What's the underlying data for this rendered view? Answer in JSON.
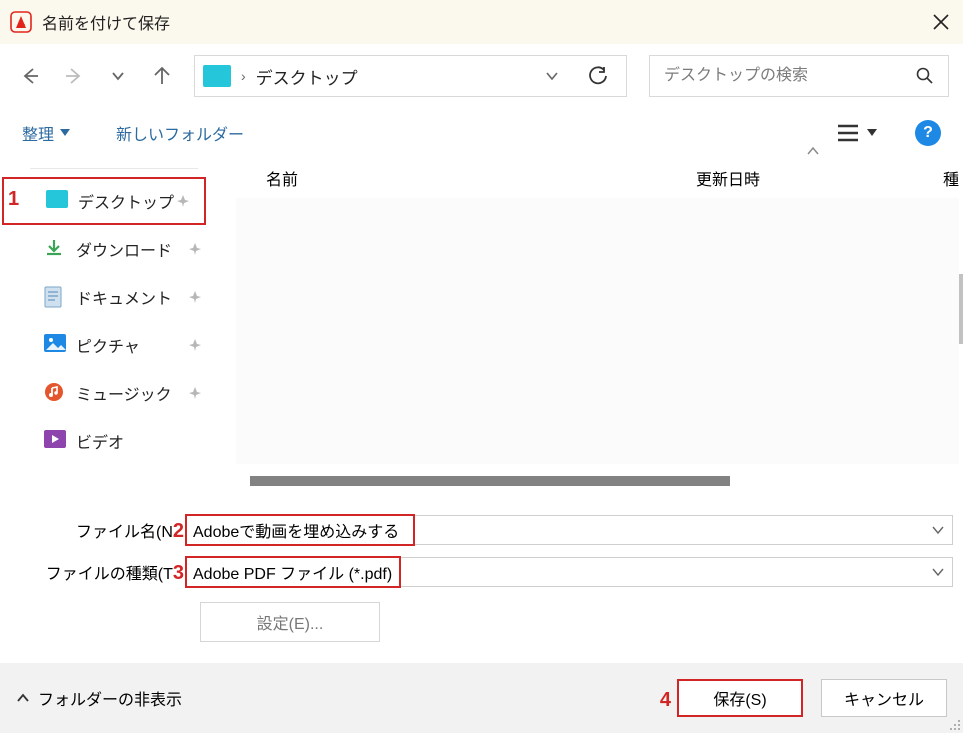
{
  "window": {
    "title": "名前を付けて保存"
  },
  "nav": {
    "path_location": "デスクトップ"
  },
  "search": {
    "placeholder": "デスクトップの検索"
  },
  "toolbar": {
    "organize": "整理",
    "new_folder": "新しいフォルダー",
    "help": "?"
  },
  "sidebar": {
    "items": [
      {
        "label": "デスクトップ",
        "icon": "desktop",
        "color": "#26c6da"
      },
      {
        "label": "ダウンロード",
        "icon": "download",
        "color": "#3aa555"
      },
      {
        "label": "ドキュメント",
        "icon": "document",
        "color": "#7ea6c9"
      },
      {
        "label": "ピクチャ",
        "icon": "picture",
        "color": "#1e88e5"
      },
      {
        "label": "ミュージック",
        "icon": "music",
        "color": "#e4572e"
      },
      {
        "label": "ビデオ",
        "icon": "video",
        "color": "#8e44ad"
      }
    ]
  },
  "columns": {
    "name": "名前",
    "modified": "更新日時",
    "type": "種"
  },
  "fields": {
    "filename_label": "ファイル名(N):",
    "filename_label_vis": "ファイル名(N",
    "filename_value": "Adobeで動画を埋め込みする",
    "filetype_label": "ファイルの種類(T):",
    "filetype_label_vis": "ファイルの種類(T",
    "filetype_value": "Adobe PDF ファイル (*.pdf)",
    "settings_btn": "設定(E)..."
  },
  "bottom": {
    "hide_folders": "フォルダーの非表示",
    "save": "保存(S)",
    "cancel": "キャンセル"
  },
  "annotations": {
    "a1": "1",
    "a2": "2",
    "a3": "3",
    "a4": "4"
  }
}
